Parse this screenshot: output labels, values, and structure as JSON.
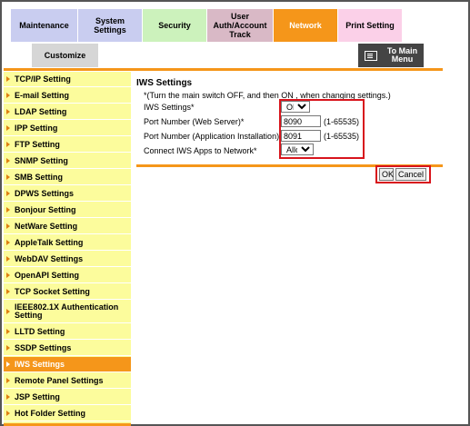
{
  "tabs": {
    "maintenance": "Maintenance",
    "system_settings": "System Settings",
    "security": "Security",
    "user_auth": [
      "User",
      "Auth/Account",
      "Track"
    ],
    "network": "Network",
    "print_setting": "Print Setting",
    "customize": "Customize"
  },
  "to_main_menu": [
    "To Main",
    "Menu"
  ],
  "sidebar": {
    "items": [
      {
        "label": "TCP/IP Setting"
      },
      {
        "label": "E-mail Setting"
      },
      {
        "label": "LDAP Setting"
      },
      {
        "label": "IPP Setting"
      },
      {
        "label": "FTP Setting"
      },
      {
        "label": "SNMP Setting"
      },
      {
        "label": "SMB Setting"
      },
      {
        "label": "DPWS Settings"
      },
      {
        "label": "Bonjour Setting"
      },
      {
        "label": "NetWare Setting"
      },
      {
        "label": "AppleTalk Setting"
      },
      {
        "label": "WebDAV Settings"
      },
      {
        "label": "OpenAPI Setting"
      },
      {
        "label": "TCP Socket Setting"
      },
      {
        "label": "IEEE802.1X Authentication Setting"
      },
      {
        "label": "LLTD Setting"
      },
      {
        "label": "SSDP Settings"
      },
      {
        "label": "IWS Settings"
      },
      {
        "label": "Remote Panel Settings"
      },
      {
        "label": "JSP Setting"
      },
      {
        "label": "Hot Folder Setting"
      }
    ],
    "active": "IWS Settings"
  },
  "content": {
    "title": "IWS Settings",
    "note": "*(Turn the main switch OFF, and then ON , when changing settings.)",
    "iws_settings_label": "IWS Settings*",
    "iws_settings_value": "ON",
    "web_server_port_label": "Port Number (Web Server)*",
    "web_server_port_value": "8090",
    "web_server_port_range": "(1-65535)",
    "app_install_port_label": "Port Number (Application Installation)*",
    "app_install_port_value": "8091",
    "app_install_port_range": "(1-65535)",
    "connect_apps_label": "Connect IWS Apps to Network*",
    "connect_apps_value": "Allow"
  },
  "buttons": {
    "ok": "OK",
    "cancel": "Cancel"
  },
  "colors": {
    "accent": "#f5961a",
    "sidebar_bg": "#fcfc9c",
    "highlight_box": "#d8141c"
  }
}
